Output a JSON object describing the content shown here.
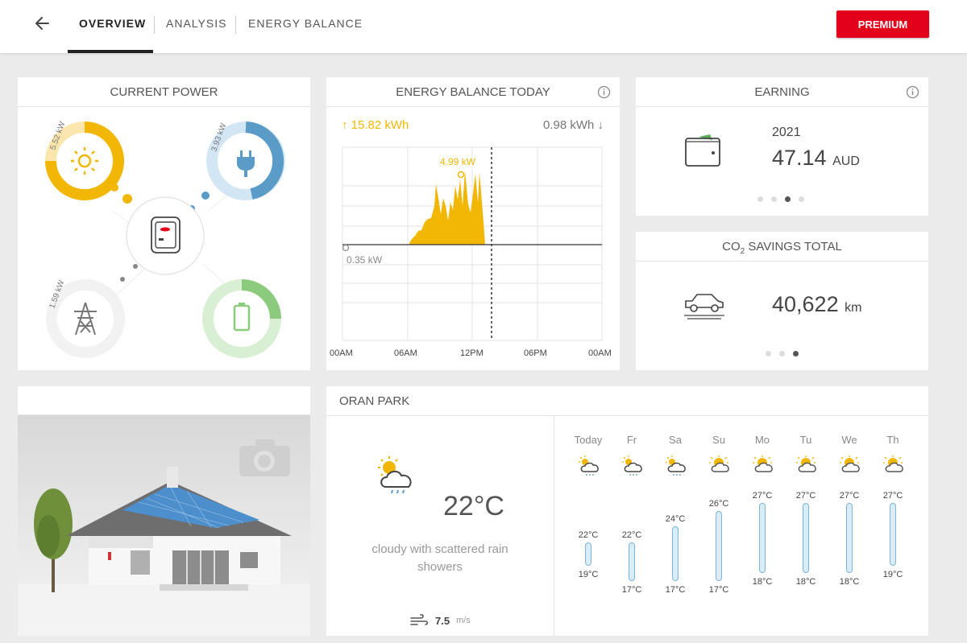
{
  "header": {
    "tabs": [
      {
        "label": "OVERVIEW",
        "active": true
      },
      {
        "label": "ANALYSIS",
        "active": false
      },
      {
        "label": "ENERGY BALANCE",
        "active": false
      }
    ],
    "premium_label": "PREMIUM"
  },
  "current_power": {
    "title": "CURRENT POWER",
    "pv": {
      "value": "5.52 kW",
      "icon": "sun-icon",
      "color": "#f2b705"
    },
    "consumption": {
      "value": "3.93 kW",
      "icon": "plug-icon",
      "color": "#5a9cc7"
    },
    "grid": {
      "value": "1.59 kW",
      "icon": "power-pylon-icon",
      "color": "#777777"
    },
    "battery": {
      "icon": "battery-icon",
      "color": "#8ccb7d"
    }
  },
  "energy_balance": {
    "title": "ENERGY BALANCE TODAY",
    "produced": "↑ 15.82 kWh",
    "consumed": "0.98 kWh ↓",
    "peak_label": "4.99 kW",
    "low_label": "0.35 kW",
    "x_labels": [
      "00AM",
      "06AM",
      "12PM",
      "06PM",
      "00AM"
    ]
  },
  "earning": {
    "title": "EARNING",
    "year": "2021",
    "amount": "47.14",
    "currency": "AUD",
    "page_index": 2,
    "page_count": 4
  },
  "co2": {
    "title_prefix": "CO",
    "title_sub": "2",
    "title_suffix": " SAVINGS TOTAL",
    "value": "40,622",
    "unit": "km",
    "page_index": 2,
    "page_count": 3
  },
  "weather": {
    "location": "ORAN PARK",
    "current_temp": "22°C",
    "description": "cloudy with scattered rain showers",
    "wind_value": "7.5",
    "wind_unit": "m/s",
    "forecast": [
      {
        "day": "Today",
        "icon": "sun-cloud-rain-icon",
        "high": "22°C",
        "low": "19°C",
        "high_c": 22,
        "low_c": 19
      },
      {
        "day": "Fr",
        "icon": "sun-cloud-rain-icon",
        "high": "22°C",
        "low": "17°C",
        "high_c": 22,
        "low_c": 17
      },
      {
        "day": "Sa",
        "icon": "sun-cloud-rain-icon",
        "high": "24°C",
        "low": "17°C",
        "high_c": 24,
        "low_c": 17
      },
      {
        "day": "Su",
        "icon": "sun-cloud-icon",
        "high": "26°C",
        "low": "17°C",
        "high_c": 26,
        "low_c": 17
      },
      {
        "day": "Mo",
        "icon": "sun-cloud-icon",
        "high": "27°C",
        "low": "18°C",
        "high_c": 27,
        "low_c": 18
      },
      {
        "day": "Tu",
        "icon": "sun-cloud-icon",
        "high": "27°C",
        "low": "18°C",
        "high_c": 27,
        "low_c": 18
      },
      {
        "day": "We",
        "icon": "sun-cloud-icon",
        "high": "27°C",
        "low": "18°C",
        "high_c": 27,
        "low_c": 18
      },
      {
        "day": "Th",
        "icon": "sun-cloud-icon",
        "high": "27°C",
        "low": "19°C",
        "high_c": 27,
        "low_c": 19
      }
    ]
  },
  "colors": {
    "accent_red": "#e2001a",
    "solar_yellow": "#f2b705",
    "consumption_blue": "#5a9cc7",
    "battery_green": "#8ccb7d"
  }
}
